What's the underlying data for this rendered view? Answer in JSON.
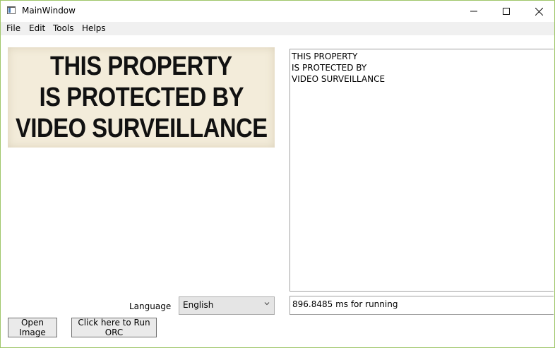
{
  "window": {
    "title": "MainWindow",
    "icon": "app-window-icon"
  },
  "caption_buttons": {
    "minimize": "—",
    "maximize": "☐",
    "close": "✕"
  },
  "menu": [
    {
      "label": "File"
    },
    {
      "label": "Edit"
    },
    {
      "label": "Tools"
    },
    {
      "label": "Helps"
    }
  ],
  "image_preview": {
    "lines": [
      "THIS PROPERTY",
      "IS PROTECTED BY",
      "VIDEO SURVEILLANCE"
    ]
  },
  "ocr_output": {
    "lines": [
      "THIS PROPERTY",
      "IS PROTECTED BY",
      "VIDEO SURVEILLANCE"
    ]
  },
  "language": {
    "label": "Language",
    "selected": "English"
  },
  "status": {
    "text": "896.8485 ms for running"
  },
  "buttons": {
    "open_image": "Open Image",
    "run_ocr": "Click here to Run ORC"
  }
}
